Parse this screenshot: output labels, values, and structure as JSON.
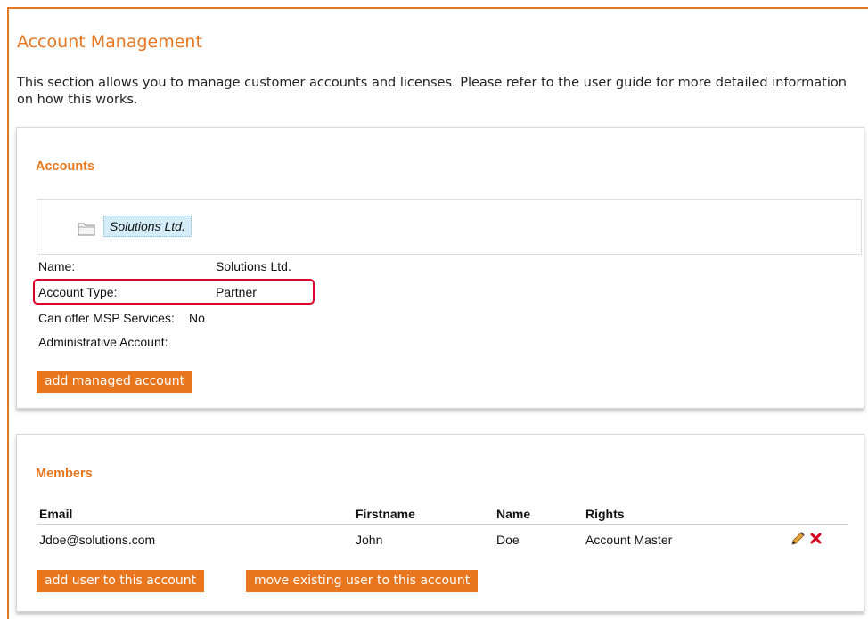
{
  "page": {
    "title": "Account Management",
    "intro": "This section allows you to manage customer accounts and licenses. Please refer to the user guide for more detailed information on how this works."
  },
  "accounts": {
    "title": "Accounts",
    "tree_node": "Solutions Ltd.",
    "fields": [
      {
        "label": "Name:",
        "value": "Solutions Ltd."
      },
      {
        "label": "Account Type:",
        "value": "Partner"
      },
      {
        "label": "Can offer MSP Services:",
        "value": "No"
      },
      {
        "label": "Administrative Account:",
        "value": ""
      }
    ],
    "add_managed_label": "add managed account"
  },
  "members": {
    "title": "Members",
    "columns": [
      "Email",
      "Firstname",
      "Name",
      "Rights"
    ],
    "rows": [
      {
        "email": "Jdoe@solutions.com",
        "firstname": "John",
        "name": "Doe",
        "rights": "Account Master"
      }
    ],
    "add_user_label": "add user to this account",
    "move_user_label": "move existing user to this account"
  },
  "colors": {
    "accent": "#e8761f",
    "highlight": "#e0002a",
    "node_bg": "#d3ecf7"
  },
  "icons": [
    "folder-icon",
    "pencil-icon",
    "delete-x-icon"
  ]
}
